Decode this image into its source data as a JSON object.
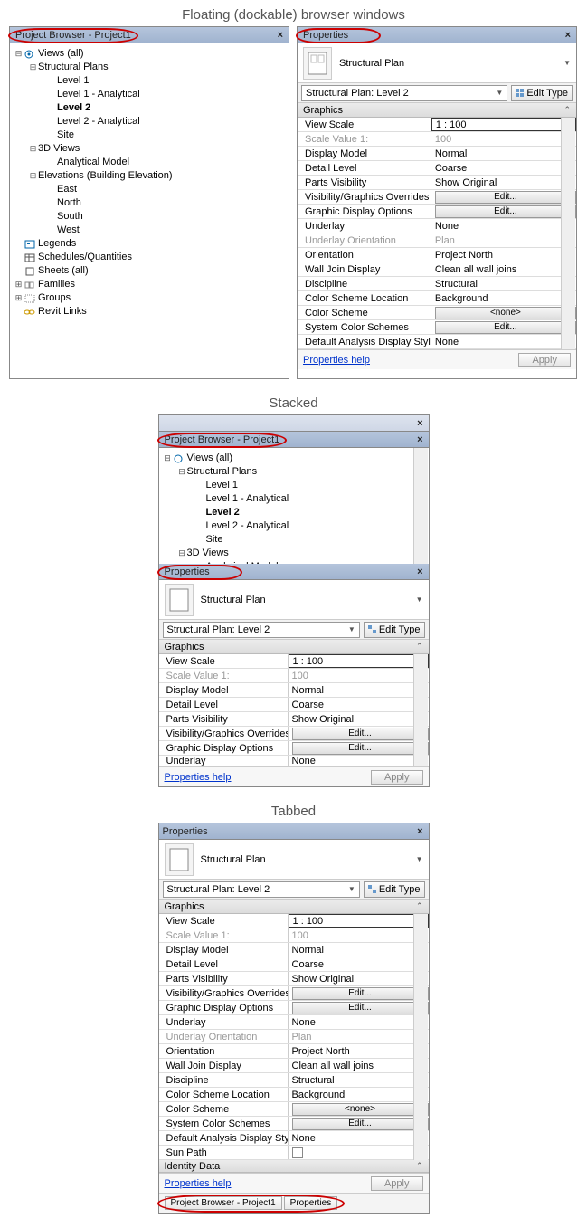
{
  "headings": {
    "floating": "Floating (dockable) browser windows",
    "stacked": "Stacked",
    "tabbed": "Tabbed"
  },
  "browser": {
    "title": "Project Browser - Project1",
    "close": "×",
    "tree": {
      "root": "Views (all)",
      "structural_plans": "Structural Plans",
      "level1": "Level 1",
      "level1a": "Level 1 - Analytical",
      "level2": "Level 2",
      "level2a": "Level 2 - Analytical",
      "site": "Site",
      "views3d": "3D Views",
      "analytical": "Analytical Model",
      "elevations": "Elevations (Building Elevation)",
      "east": "East",
      "north": "North",
      "south": "South",
      "west": "West",
      "legends": "Legends",
      "schedules": "Schedules/Quantities",
      "sheets": "Sheets (all)",
      "families": "Families",
      "groups": "Groups",
      "revitlinks": "Revit Links"
    }
  },
  "properties": {
    "title": "Properties",
    "close": "×",
    "family_name": "Structural Plan",
    "instance": "Structural Plan: Level 2",
    "edit_type": "Edit Type",
    "group_graphics": "Graphics",
    "group_identity": "Identity Data",
    "rows": {
      "view_scale": {
        "n": "View Scale",
        "v": "1 : 100"
      },
      "scale_value": {
        "n": "Scale Value    1:",
        "v": "100"
      },
      "display_model": {
        "n": "Display Model",
        "v": "Normal"
      },
      "detail_level": {
        "n": "Detail Level",
        "v": "Coarse"
      },
      "parts_vis": {
        "n": "Parts Visibility",
        "v": "Show Original"
      },
      "vg_overrides": {
        "n": "Visibility/Graphics Overrides",
        "v": "Edit..."
      },
      "disp_opts": {
        "n": "Graphic Display Options",
        "v": "Edit..."
      },
      "underlay": {
        "n": "Underlay",
        "v": "None"
      },
      "underlay_orient": {
        "n": "Underlay Orientation",
        "v": "Plan"
      },
      "orientation": {
        "n": "Orientation",
        "v": "Project North"
      },
      "wall_join": {
        "n": "Wall Join Display",
        "v": "Clean all wall joins"
      },
      "discipline": {
        "n": "Discipline",
        "v": "Structural"
      },
      "color_loc": {
        "n": "Color Scheme Location",
        "v": "Background"
      },
      "color_scheme": {
        "n": "Color Scheme",
        "v": "<none>"
      },
      "sys_color": {
        "n": "System Color Schemes",
        "v": "Edit..."
      },
      "def_analysis": {
        "n": "Default Analysis Display Style",
        "v": "None"
      },
      "sun_path": {
        "n": "Sun Path",
        "v": ""
      }
    },
    "help": "Properties help",
    "apply": "Apply"
  },
  "tabs": {
    "browser": "Project Browser - Project1",
    "props": "Properties"
  }
}
